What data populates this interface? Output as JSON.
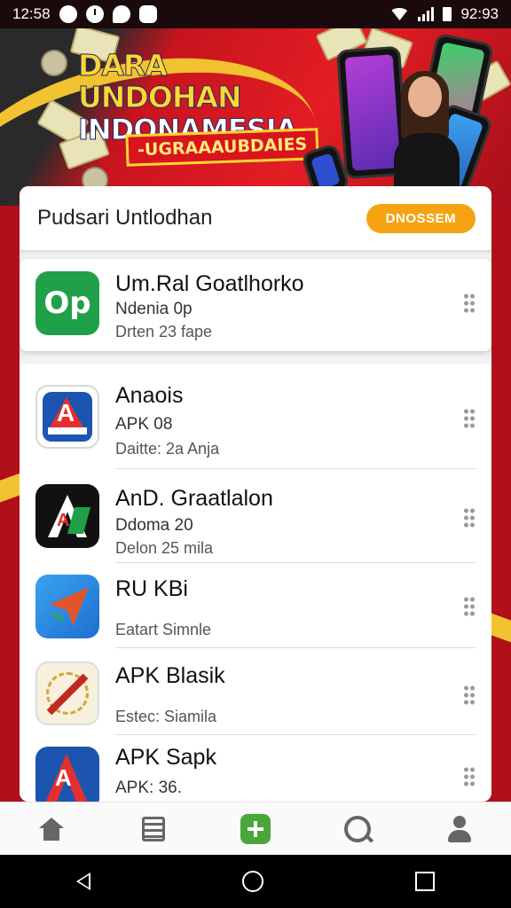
{
  "status_bar": {
    "time": "12:58",
    "battery": "92:93"
  },
  "banner": {
    "title_line1": "DARA UNDOHAN",
    "title_line2": "INDONAMESIA",
    "subtitle": "-UGRAAAUBDAIES"
  },
  "header": {
    "title": "Pudsari Untlodhan",
    "button_label": "DNOSSEM",
    "accent_color": "#f5a313"
  },
  "featured": {
    "icon_text": "Op",
    "name": "Um.Ral Goatlhorko",
    "line2": "Ndenia 0p",
    "line3": "Drten 23 fape"
  },
  "apps": [
    {
      "name": "Anaois",
      "line2": "APK 08",
      "line3": "Daitte: 2a Anja",
      "icon_text": "A"
    },
    {
      "name": "AnD. Graatlalon",
      "line2": "Ddoma 20",
      "line3": "Delon 25 mila",
      "icon_text": "A"
    },
    {
      "name": "RU KBi",
      "line2": "",
      "line3": "Eatart Simnle",
      "icon_text": ""
    },
    {
      "name": "APK Blasik",
      "line2": "",
      "line3": "Estec: Siamila",
      "icon_text": ""
    },
    {
      "name": "APK Sapk",
      "line2": "APK: 36.",
      "line3": "",
      "icon_text": "A"
    }
  ],
  "bottom_nav": [
    "home-icon",
    "list-icon",
    "add-icon",
    "search-icon",
    "profile-icon"
  ]
}
